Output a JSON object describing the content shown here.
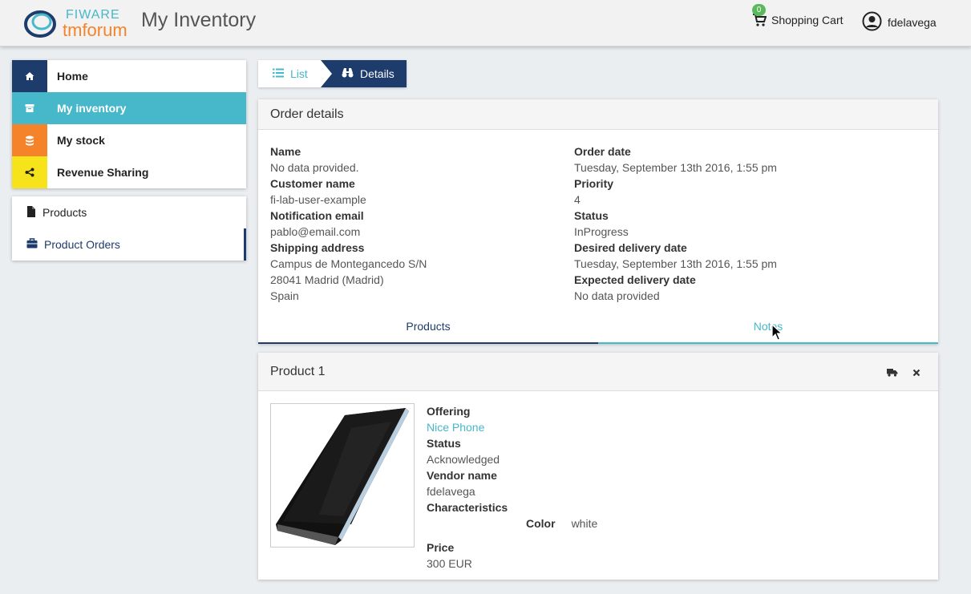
{
  "header": {
    "logo_top": "FIWARE",
    "logo_bottom": "tmforum",
    "title": "My Inventory",
    "cart_count": "0",
    "cart_label": "Shopping Cart",
    "username": "fdelavega"
  },
  "nav": {
    "items": [
      {
        "label": "Home",
        "color": "#1d3b6b",
        "icon": "home-icon"
      },
      {
        "label": "My inventory",
        "color": "#46b8c9",
        "icon": "archive-icon"
      },
      {
        "label": "My stock",
        "color": "#f5832a",
        "icon": "database-icon"
      },
      {
        "label": "Revenue Sharing",
        "color": "#f7e31b",
        "icon": "share-icon"
      }
    ],
    "sub_items": [
      {
        "label": "Products",
        "icon": "file-icon"
      },
      {
        "label": "Product Orders",
        "icon": "briefcase-icon"
      }
    ]
  },
  "breadcrumb": {
    "list_label": "List",
    "details_label": "Details"
  },
  "order": {
    "title": "Order details",
    "left": {
      "name_label": "Name",
      "name_value": "No data provided.",
      "customer_label": "Customer name",
      "customer_value": "fi-lab-user-example",
      "email_label": "Notification email",
      "email_value": "pablo@email.com",
      "address_label": "Shipping address",
      "address_line1": "Campus de Montegancedo S/N",
      "address_line2": "28041 Madrid (Madrid)",
      "address_line3": "Spain"
    },
    "right": {
      "order_date_label": "Order date",
      "order_date_value": "Tuesday, September 13th 2016, 1:55 pm",
      "priority_label": "Priority",
      "priority_value": "4",
      "status_label": "Status",
      "status_value": "InProgress",
      "desired_label": "Desired delivery date",
      "desired_value": "Tuesday, September 13th 2016, 1:55 pm",
      "expected_label": "Expected delivery date",
      "expected_value": "No data provided"
    },
    "tabs": {
      "products": "Products",
      "notes": "Notes"
    }
  },
  "product": {
    "title": "Product 1",
    "offering_label": "Offering",
    "offering_value": "Nice Phone",
    "status_label": "Status",
    "status_value": "Acknowledged",
    "vendor_label": "Vendor name",
    "vendor_value": "fdelavega",
    "characteristics_label": "Characteristics",
    "char_key": "Color",
    "char_value": "white",
    "price_label": "Price",
    "price_value": "300 EUR"
  }
}
